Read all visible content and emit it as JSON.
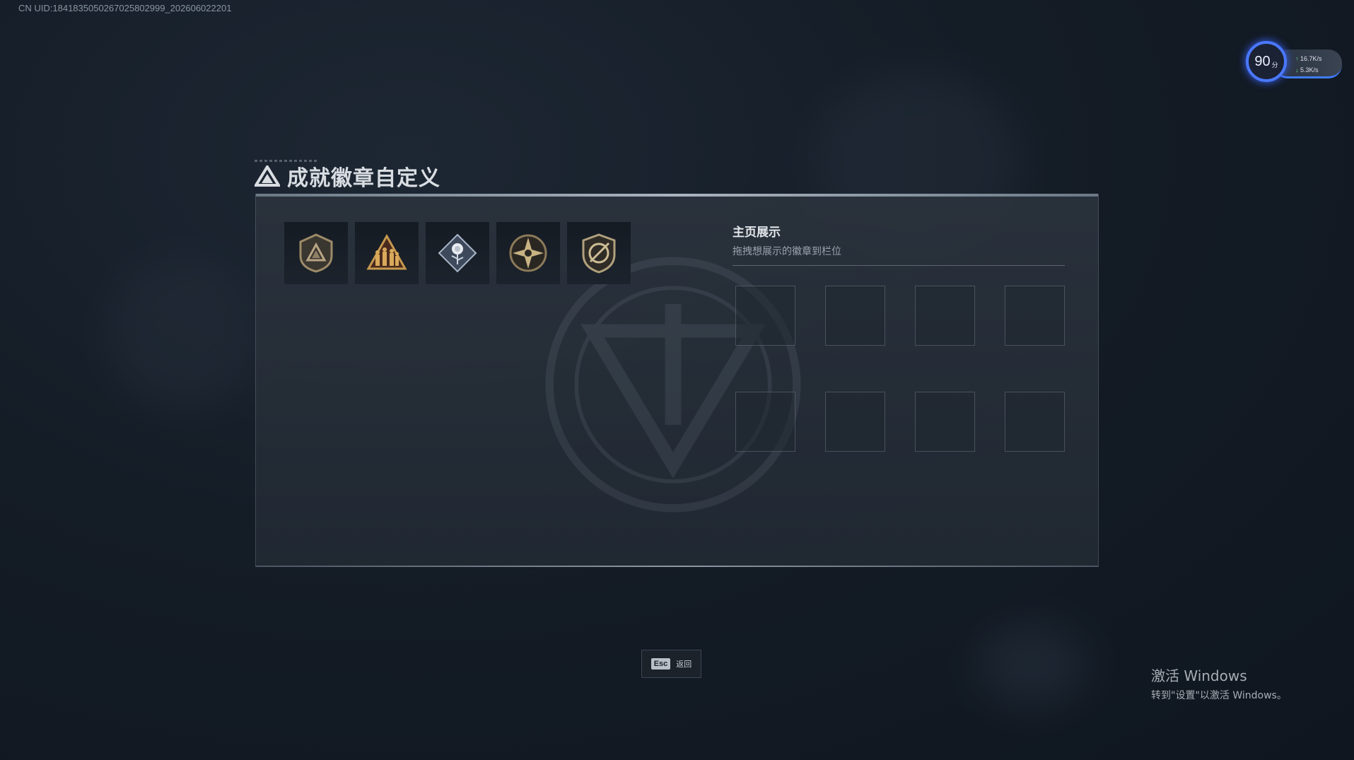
{
  "uid_text": "CN UID:1841835050267025802999_202606022201",
  "fps_widget": {
    "fps": "90",
    "unit": "分",
    "upload": "16.7K/s",
    "download": "5.3K/s"
  },
  "header": {
    "title": "成就徽章自定义"
  },
  "badges": [
    {
      "name": "triangle-shield-badge"
    },
    {
      "name": "soldiers-triangle-badge"
    },
    {
      "name": "rose-diamond-badge"
    },
    {
      "name": "star-compass-badge"
    },
    {
      "name": "crossed-shield-badge"
    }
  ],
  "showcase": {
    "title": "主页展示",
    "subtitle": "拖拽想展示的徽章到栏位",
    "slot_count": 8
  },
  "footer": {
    "esc_key": "Esc",
    "esc_label": "返回"
  },
  "watermark": {
    "line1": "激活 Windows",
    "line2": "转到\"设置\"以激活 Windows。"
  }
}
